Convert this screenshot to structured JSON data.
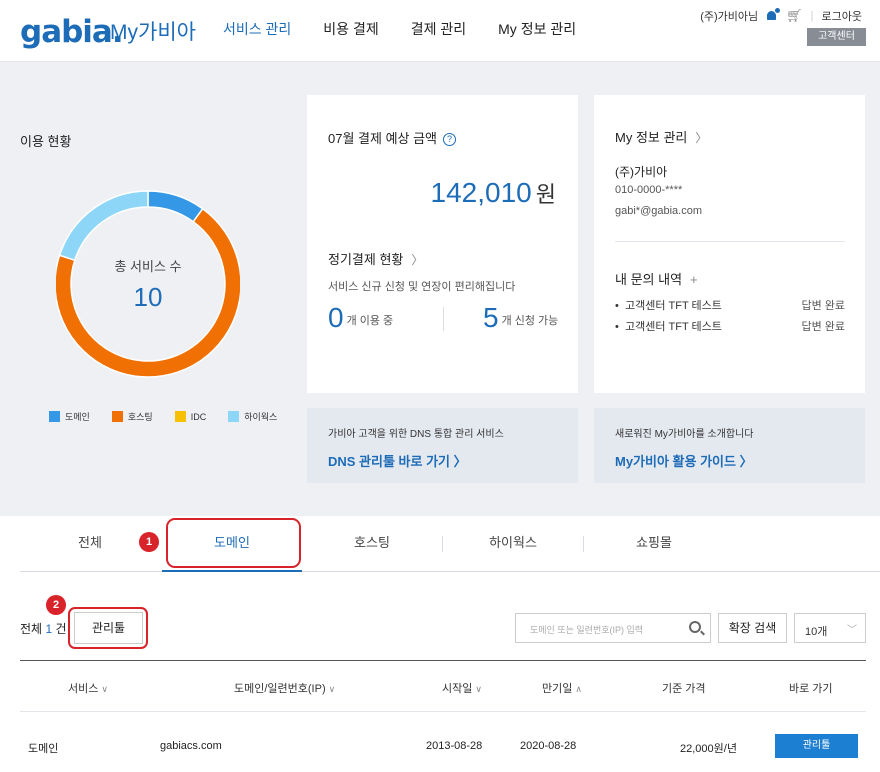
{
  "header": {
    "logo": "gabia.",
    "logo_sub": "My가비아",
    "nav": [
      "서비스 관리",
      "비용 결제",
      "결제 관리",
      "My 정보 관리"
    ],
    "nav_active_index": 0,
    "user_name": "(주)가비아님",
    "bell_count": "0",
    "logout": "로그아웃",
    "help_center": "고객센터"
  },
  "usage": {
    "title": "이용 현황",
    "center_label": "총 서비스 수",
    "center_value": "10",
    "chart_data": {
      "type": "pie",
      "categories": [
        "도메인",
        "호스팅",
        "IDC",
        "하이웍스"
      ],
      "values": [
        1,
        7,
        0,
        2
      ],
      "colors": [
        "#3498e6",
        "#f07003",
        "#f5c100",
        "#8ed6f8"
      ]
    }
  },
  "payment": {
    "title": "07월 결제 예상 금액",
    "help": "?",
    "amount": "142,010",
    "unit": "원",
    "recurring_title": "정기결제 현황",
    "recurring_desc": "서비스 신규 신청 및 연장이 편리해집니다",
    "in_use_count": "0",
    "in_use_label": "개 이용 중",
    "available_count": "5",
    "available_label": "개 신청 가능"
  },
  "my_info": {
    "title": "My 정보 관리",
    "company": "(주)가비아",
    "phone": "010-0000-****",
    "email": "gabi*@gabia.com",
    "inquiry_title": "내 문의 내역",
    "inquiries": [
      {
        "title": "고객센터 TFT 테스트",
        "status": "답변 완료"
      },
      {
        "title": "고객센터 TFT 테스트",
        "status": "답변 완료"
      }
    ]
  },
  "promo_dns": {
    "desc": "가비아 고객을 위한 DNS 통합 관리 서비스",
    "link": "DNS 관리툴 바로 가기"
  },
  "promo_guide": {
    "desc": "새로워진 My가비아를 소개합니다",
    "link": "My가비아 활용 가이드"
  },
  "tabs": [
    "전체",
    "도메인",
    "호스팅",
    "하이웍스",
    "쇼핑몰"
  ],
  "tab_active_index": 1,
  "badges": [
    "1",
    "2"
  ],
  "list": {
    "total_label": "전체",
    "total_count": "1",
    "total_unit": "건",
    "manage_button": "관리툴",
    "search_placeholder": "도메인 또는 일련번호(IP) 입력",
    "extended_search": "확장 검색",
    "page_size": "10개"
  },
  "table": {
    "headers": [
      "서비스",
      "도메인/일련번호(IP)",
      "시작일",
      "만기일",
      "기준 가격",
      "바로 가기"
    ],
    "rows": [
      {
        "service": "도메인",
        "domain": "gabiacs.com",
        "start": "2013-08-28",
        "expiry": "2020-08-28",
        "price": "22,000원/년",
        "action": "관리툴"
      }
    ]
  }
}
